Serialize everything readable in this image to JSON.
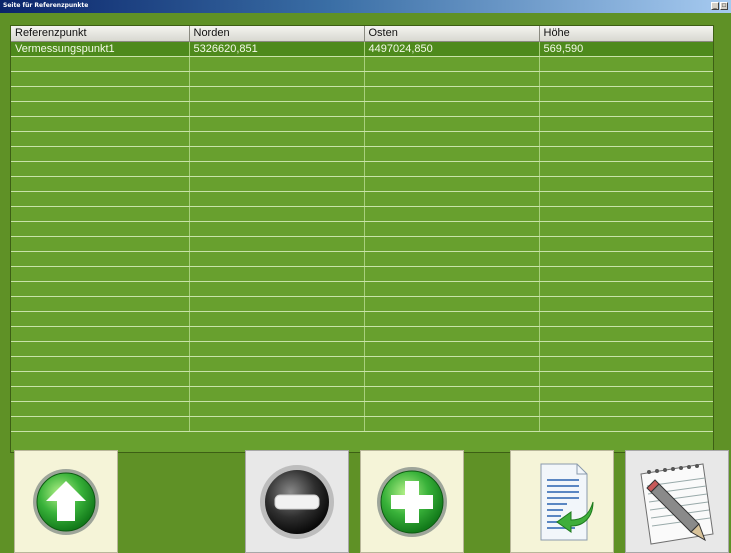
{
  "window": {
    "title": "Seite für Referenzpunkte",
    "controls": [
      "_",
      "□"
    ]
  },
  "table": {
    "columns": [
      "Referenzpunkt",
      "Norden",
      "Osten",
      "Höhe"
    ],
    "rows": [
      [
        "Vermessungspunkt1",
        "5326620,851",
        "4497024,850",
        "569,590"
      ]
    ],
    "empty_rows": 25
  },
  "toolbar": {
    "buttons": [
      {
        "name": "move-up-button",
        "icon": "arrow-up-icon"
      },
      {
        "name": "remove-button",
        "icon": "minus-icon"
      },
      {
        "name": "add-button",
        "icon": "plus-icon"
      },
      {
        "name": "import-button",
        "icon": "document-import-icon"
      },
      {
        "name": "edit-button",
        "icon": "notepad-pencil-icon"
      }
    ]
  },
  "colors": {
    "background": "#5f9126",
    "grid": "#68a02e",
    "selected_row": "#4e8a1c",
    "button_face": "#f5f4d8"
  }
}
